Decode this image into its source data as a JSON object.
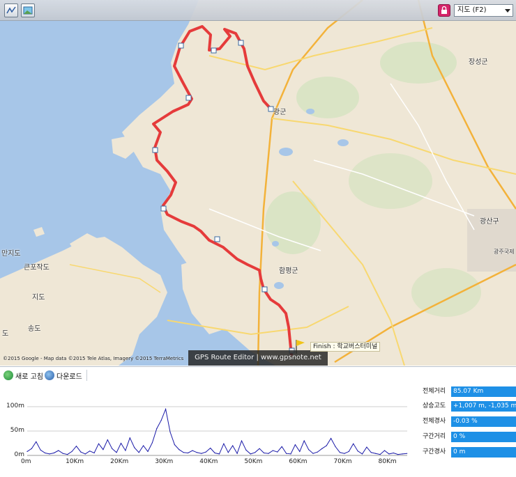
{
  "map": {
    "type_select": "지도 (F2)",
    "places": {
      "jangseong": "장성군",
      "yeonggwang": "광군",
      "hampyeong": "함평군",
      "gwangsangu": "광산구",
      "gwangjugukje": "광주국제",
      "manjido": "만지도",
      "keunpojakdo": "큰포작도",
      "jido": "지도",
      "songdo": "송도",
      "do_edge": "도"
    },
    "attribution": "©2015 Google - Map data ©2015 Tele Atlas, Imagery ©2015 TerraMetrics",
    "brand": "GPS Route Editor | www.gpsnote.net",
    "finish_label": "Finish : 학교버스터미널"
  },
  "toolbar": {
    "refresh_label": "새로 고침",
    "download_label": "다운로드"
  },
  "chart_data": {
    "type": "area",
    "title": "",
    "xlabel": "",
    "ylabel": "",
    "x_tick_labels": [
      "0m",
      "10Km",
      "20Km",
      "30Km",
      "40Km",
      "50Km",
      "60Km",
      "70Km",
      "80Km"
    ],
    "y_tick_labels": [
      "0m",
      "50m",
      "100m"
    ],
    "xlim": [
      0,
      85.07
    ],
    "ylim": [
      0,
      100
    ],
    "grid": true,
    "series": [
      {
        "color": "#1a1aa8",
        "x": [
          0,
          1,
          2,
          3,
          4,
          5,
          6,
          7,
          8,
          9,
          10,
          11,
          12,
          13,
          14,
          15,
          16,
          17,
          18,
          19,
          20,
          21,
          22,
          23,
          24,
          25,
          26,
          27,
          28,
          29,
          30,
          31,
          32,
          33,
          34,
          35,
          36,
          37,
          38,
          39,
          40,
          41,
          42,
          43,
          44,
          45,
          46,
          47,
          48,
          49,
          50,
          51,
          52,
          53,
          54,
          55,
          56,
          57,
          58,
          59,
          60,
          61,
          62,
          63,
          64,
          65,
          66,
          67,
          68,
          69,
          70,
          71,
          72,
          73,
          74,
          75,
          76,
          77,
          78,
          79,
          80,
          81,
          82,
          83,
          84,
          85
        ],
        "y": [
          8,
          14,
          28,
          11,
          5,
          3,
          5,
          10,
          4,
          2,
          8,
          19,
          7,
          3,
          9,
          5,
          24,
          12,
          32,
          14,
          6,
          25,
          10,
          36,
          16,
          6,
          20,
          8,
          26,
          55,
          72,
          95,
          48,
          22,
          12,
          6,
          5,
          10,
          6,
          4,
          7,
          15,
          5,
          3,
          24,
          6,
          20,
          4,
          30,
          11,
          3,
          6,
          14,
          5,
          4,
          10,
          7,
          18,
          4,
          3,
          22,
          8,
          30,
          12,
          4,
          7,
          14,
          20,
          35,
          18,
          6,
          4,
          8,
          24,
          9,
          3,
          17,
          6,
          4,
          2,
          10,
          3,
          5,
          2,
          3,
          4
        ]
      }
    ]
  },
  "stats": [
    {
      "label": "전체거리",
      "value": "85.07 Km"
    },
    {
      "label": "상승고도",
      "value": "+1,007 m, -1,035 m"
    },
    {
      "label": "전체경사",
      "value": "-0.03 %"
    },
    {
      "label": "구간거리",
      "value": "0 %"
    },
    {
      "label": "구간경사",
      "value": "0 m"
    }
  ]
}
